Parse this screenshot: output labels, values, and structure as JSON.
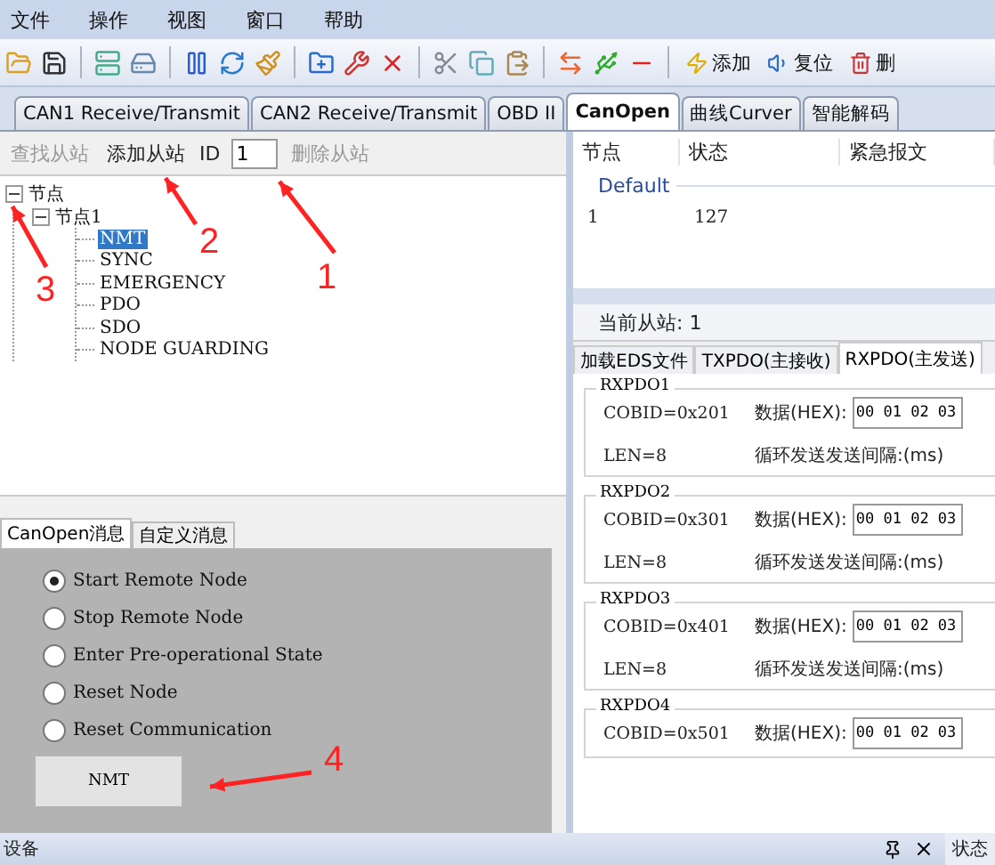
{
  "menu": [
    "文件",
    "操作",
    "视图",
    "窗口",
    "帮助"
  ],
  "toolbar_actions": [
    "添加",
    "复位",
    "删"
  ],
  "tabs": [
    {
      "label": "CAN1 Receive/Transmit",
      "selected": false
    },
    {
      "label": "CAN2 Receive/Transmit",
      "selected": false
    },
    {
      "label": "OBD II",
      "selected": false
    },
    {
      "label": "CanOpen",
      "selected": true
    },
    {
      "label": "曲线Curver",
      "selected": false
    },
    {
      "label": "智能解码",
      "selected": false
    }
  ],
  "slave_toolbar": [
    {
      "kind": "button",
      "label": "查找从站",
      "disabled": true
    },
    {
      "kind": "button",
      "label": "添加从站",
      "disabled": false
    },
    {
      "kind": "field",
      "label": "ID",
      "value": "1"
    },
    {
      "kind": "button",
      "label": "删除从站",
      "disabled": true
    }
  ],
  "tree": [
    {
      "label": "节点",
      "expanded": true,
      "selected": false,
      "children": [
        {
          "label": "节点1",
          "expanded": true,
          "selected": false,
          "children": [
            {
              "label": "NMT",
              "selected": true
            },
            {
              "label": "SYNC",
              "selected": false
            },
            {
              "label": "EMERGENCY",
              "selected": false
            },
            {
              "label": "PDO",
              "selected": false
            },
            {
              "label": "SDO",
              "selected": false
            },
            {
              "label": "NODE GUARDING",
              "selected": false
            }
          ]
        }
      ]
    }
  ],
  "message_tabs": [
    {
      "label": "CanOpen消息",
      "selected": true
    },
    {
      "label": "自定义消息",
      "selected": false
    }
  ],
  "nmt_options": [
    {
      "label": "Start Remote Node",
      "selected": true
    },
    {
      "label": "Stop Remote Node",
      "selected": false
    },
    {
      "label": "Enter Pre-operational State",
      "selected": false
    },
    {
      "label": "Reset Node",
      "selected": false
    },
    {
      "label": "Reset Communication",
      "selected": false
    }
  ],
  "nmt_button": "NMT",
  "node_table": {
    "columns": [
      "节点",
      "状态",
      "紧急报文"
    ],
    "group": "Default",
    "rows": [
      [
        "1",
        "127"
      ]
    ]
  },
  "current_slave": "当前从站: 1",
  "pdo_tabs": [
    {
      "label": "加载EDS文件",
      "selected": false
    },
    {
      "label": "TXPDO(主接收)",
      "selected": false
    },
    {
      "label": "RXPDO(主发送)",
      "selected": true
    }
  ],
  "rxpdo_groups": [
    {
      "title": "RXPDO1",
      "cobid": "COBID=0x201",
      "data_label": "数据(HEX):",
      "data_value": "00 01 02 03",
      "len": "LEN=8",
      "interval_label": "循环发送发送间隔:(ms)"
    },
    {
      "title": "RXPDO2",
      "cobid": "COBID=0x301",
      "data_label": "数据(HEX):",
      "data_value": "00 01 02 03",
      "len": "LEN=8",
      "interval_label": "循环发送发送间隔:(ms)"
    },
    {
      "title": "RXPDO3",
      "cobid": "COBID=0x401",
      "data_label": "数据(HEX):",
      "data_value": "00 01 02 03",
      "len": "LEN=8",
      "interval_label": "循环发送发送间隔:(ms)"
    },
    {
      "title": "RXPDO4",
      "cobid": "COBID=0x501",
      "data_label": "数据(HEX):",
      "data_value": "00 01 02 03"
    }
  ],
  "status_bar": {
    "left": "设备",
    "right": "状态"
  },
  "callouts": [
    "1",
    "2",
    "3",
    "4"
  ]
}
